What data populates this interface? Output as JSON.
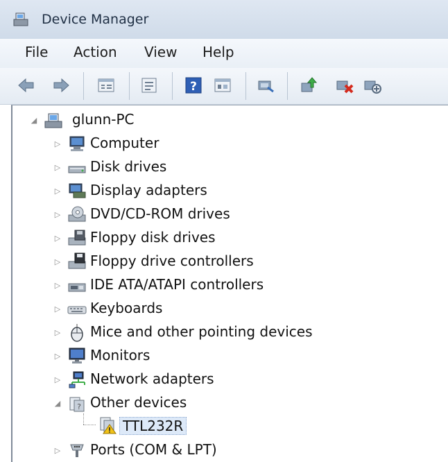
{
  "window": {
    "title": "Device Manager"
  },
  "menu": {
    "items": [
      "File",
      "Action",
      "View",
      "Help"
    ]
  },
  "toolbar": {
    "buttons": [
      {
        "name": "back-icon"
      },
      {
        "name": "forward-icon"
      },
      {
        "name": "properties-grid-icon"
      },
      {
        "name": "details-icon"
      },
      {
        "name": "help-icon"
      },
      {
        "name": "console-tree-icon"
      },
      {
        "name": "scan-hardware-icon"
      },
      {
        "name": "update-driver-icon"
      },
      {
        "name": "uninstall-icon"
      },
      {
        "name": "disable-device-icon"
      }
    ]
  },
  "tree": {
    "root": "glunn-PC",
    "categories": [
      {
        "label": "Computer",
        "icon": "computer-icon",
        "expanded": false
      },
      {
        "label": "Disk drives",
        "icon": "disk-drive-icon",
        "expanded": false
      },
      {
        "label": "Display adapters",
        "icon": "display-adapter-icon",
        "expanded": false
      },
      {
        "label": "DVD/CD-ROM drives",
        "icon": "dvd-drive-icon",
        "expanded": false
      },
      {
        "label": "Floppy disk drives",
        "icon": "floppy-drive-icon",
        "expanded": false
      },
      {
        "label": "Floppy drive controllers",
        "icon": "floppy-controller-icon",
        "expanded": false
      },
      {
        "label": "IDE ATA/ATAPI controllers",
        "icon": "ide-controller-icon",
        "expanded": false
      },
      {
        "label": "Keyboards",
        "icon": "keyboard-icon",
        "expanded": false
      },
      {
        "label": "Mice and other pointing devices",
        "icon": "mouse-icon",
        "expanded": false
      },
      {
        "label": "Monitors",
        "icon": "monitor-icon",
        "expanded": false
      },
      {
        "label": "Network adapters",
        "icon": "network-adapter-icon",
        "expanded": false
      },
      {
        "label": "Other devices",
        "icon": "other-devices-icon",
        "expanded": true,
        "children": [
          {
            "label": "TTL232R",
            "icon": "unknown-device-warning-icon",
            "selected": true
          }
        ]
      },
      {
        "label": "Ports (COM & LPT)",
        "icon": "ports-icon",
        "expanded": false
      }
    ]
  }
}
